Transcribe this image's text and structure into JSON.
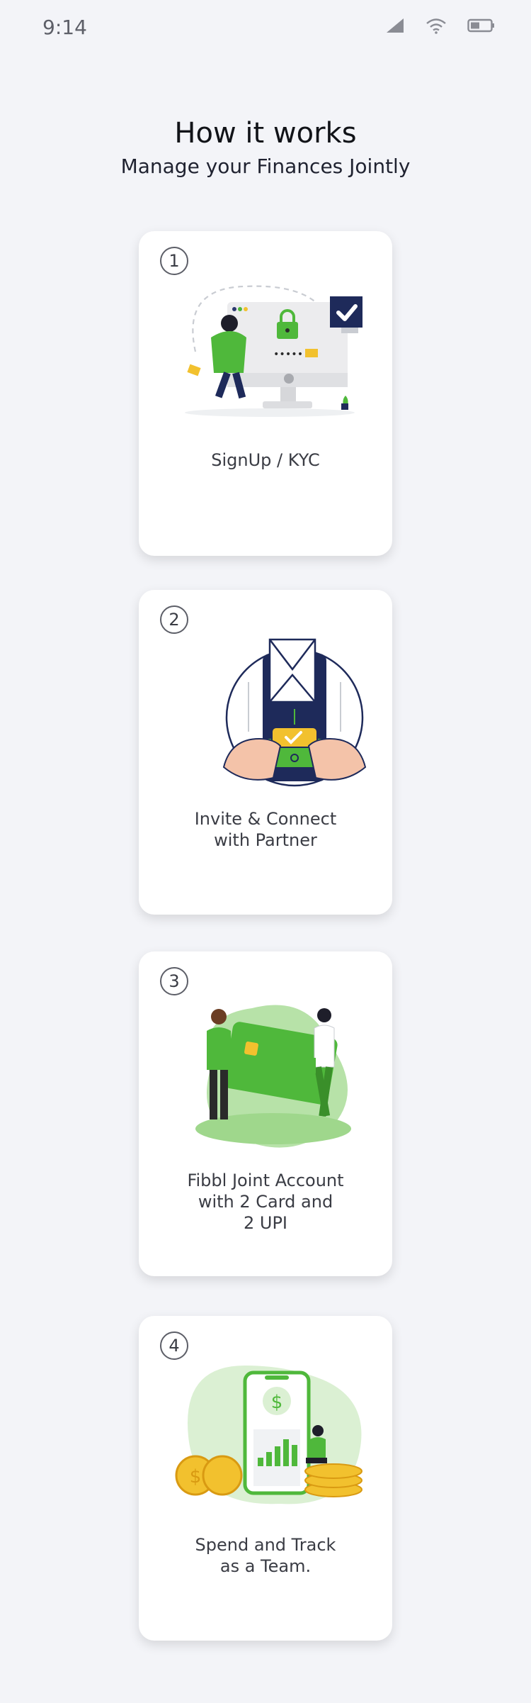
{
  "status_bar": {
    "time": "9:14"
  },
  "header": {
    "title": "How it works",
    "subtitle": "Manage your Finances Jointly"
  },
  "steps": [
    {
      "number": "1",
      "label": "SignUp / KYC"
    },
    {
      "number": "2",
      "label": "Invite & Connect\nwith Partner"
    },
    {
      "number": "3",
      "label": "Fibbl Joint Account\nwith 2 Card and\n2 UPI"
    },
    {
      "number": "4",
      "label": "Spend and Track\nas a Team."
    }
  ],
  "colors": {
    "background": "#f3f4f8",
    "brand_green": "#4fb83b",
    "navy": "#1e2a5a",
    "gold": "#f2c12e"
  }
}
